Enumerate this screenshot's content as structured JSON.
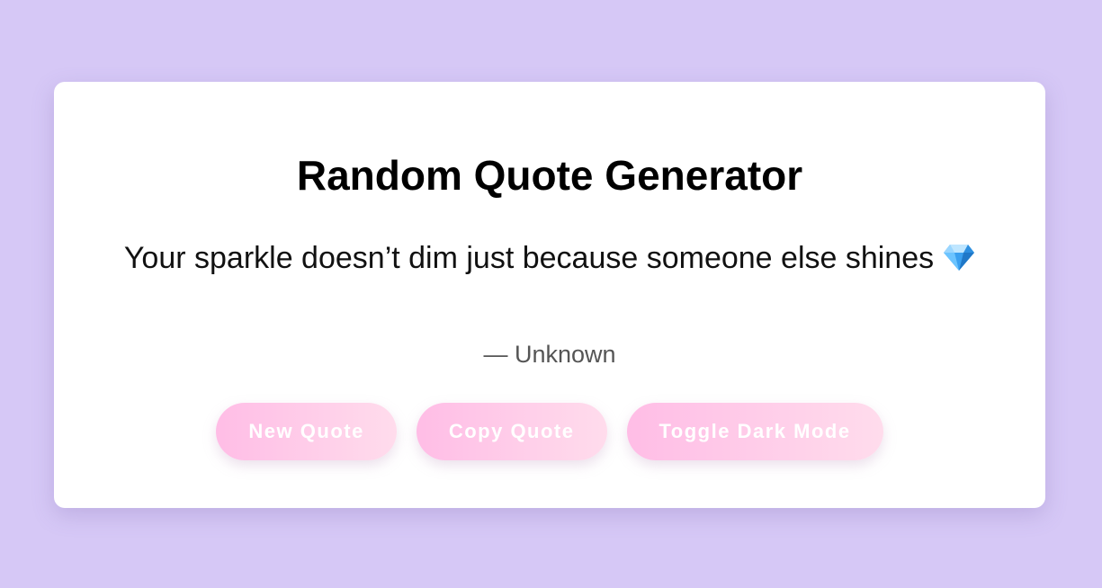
{
  "app": {
    "title": "Random Quote Generator"
  },
  "quote": {
    "text": "Your sparkle doesn’t dim just because someone else shines",
    "icon": "gem-icon",
    "author": "— Unknown"
  },
  "buttons": {
    "new_quote": "New Quote",
    "copy_quote": "Copy Quote",
    "toggle_dark_mode": "Toggle Dark Mode"
  },
  "colors": {
    "background": "#d6c8f6",
    "card": "#ffffff",
    "button_gradient_start": "#ffbde6",
    "button_gradient_end": "#ffdcec",
    "button_text": "#ffffff",
    "gem": "#3aa0f0"
  }
}
